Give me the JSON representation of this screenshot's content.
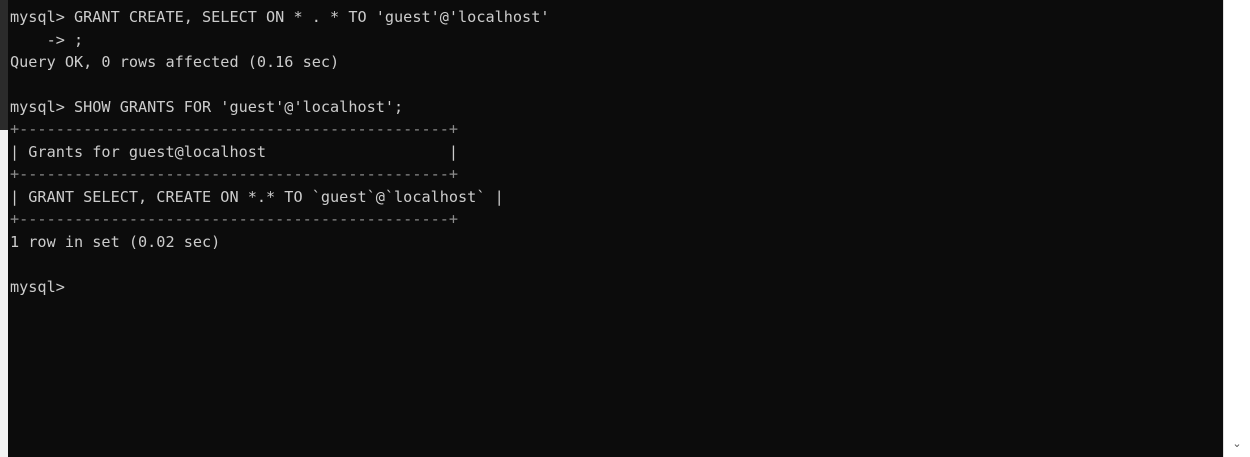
{
  "terminal": {
    "lines": [
      "mysql> GRANT CREATE, SELECT ON * . * TO 'guest'@'localhost'",
      "    -> ;",
      "Query OK, 0 rows affected (0.16 sec)",
      "",
      "mysql> SHOW GRANTS FOR 'guest'@'localhost';",
      "+-----------------------------------------------+",
      "| Grants for guest@localhost                    |",
      "+-----------------------------------------------+",
      "| GRANT SELECT, CREATE ON *.* TO `guest`@`localhost` |",
      "+-----------------------------------------------+",
      "1 row in set (0.02 sec)",
      "",
      "mysql>"
    ]
  },
  "colors": {
    "console_bg": "#0c0c0c",
    "console_text": "#cccccc"
  },
  "scrollbar": {
    "down_icon": "chevron-down-icon"
  }
}
